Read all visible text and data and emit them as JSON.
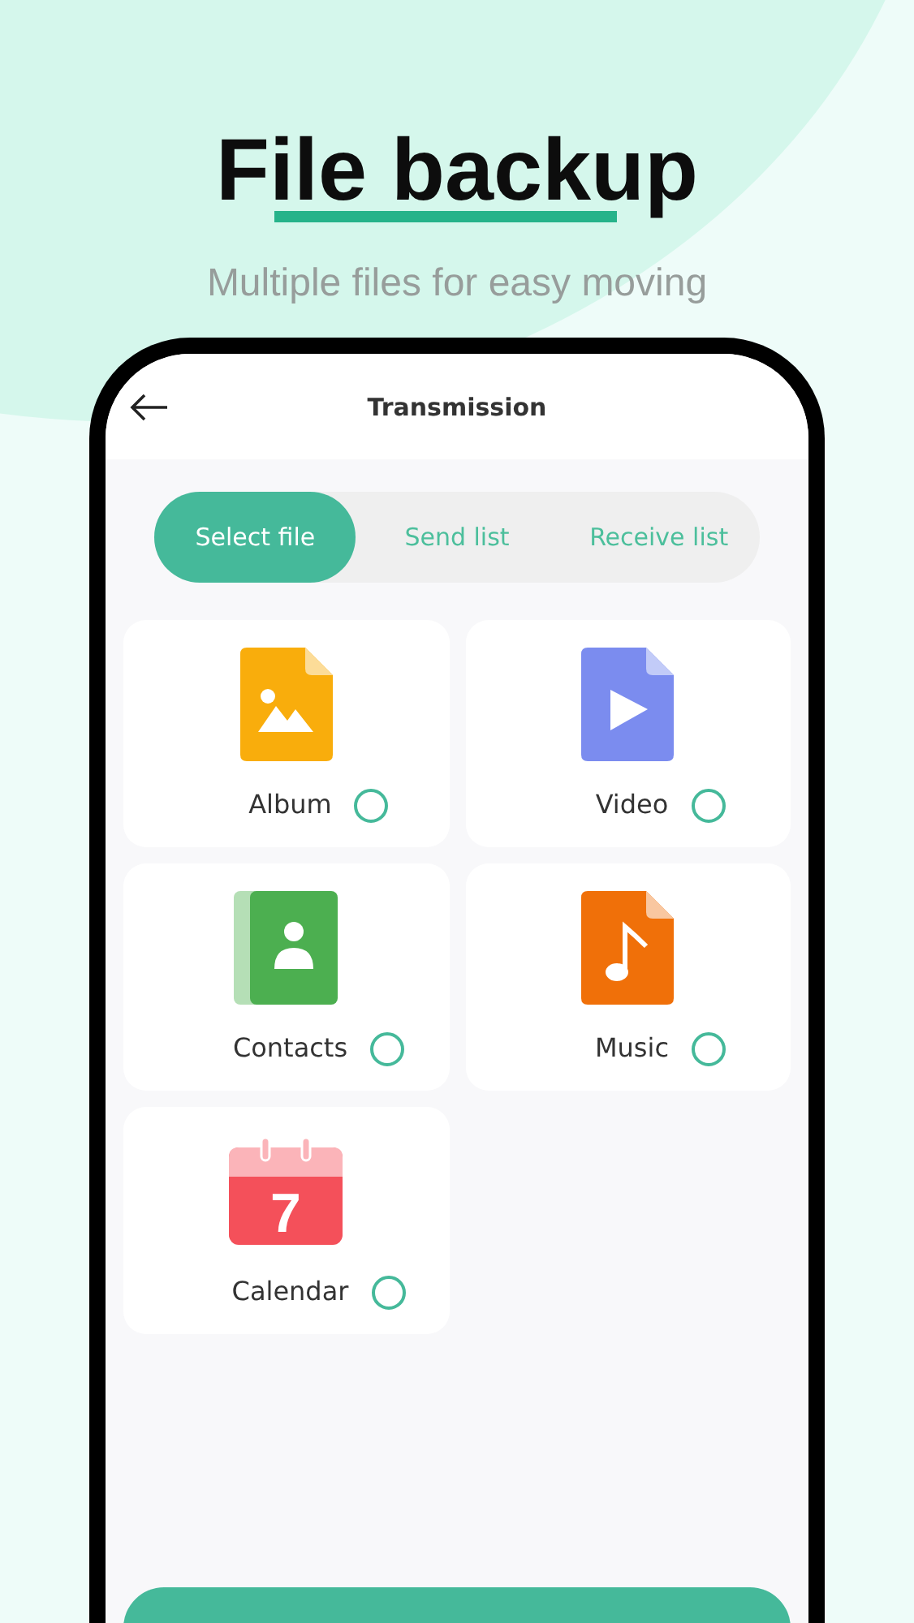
{
  "headline": "File backup",
  "subtitle": "Multiple files for easy moving",
  "screen": {
    "title": "Transmission"
  },
  "tabs": [
    {
      "label": "Select file",
      "selected": true
    },
    {
      "label": "Send list",
      "selected": false
    },
    {
      "label": "Receive list",
      "selected": false
    }
  ],
  "file_types": [
    {
      "kind": "image",
      "label": "Album",
      "checked": false
    },
    {
      "kind": "video",
      "label": "Video",
      "checked": false
    },
    {
      "kind": "contacts",
      "label": "Contacts",
      "checked": false
    },
    {
      "kind": "music",
      "label": "Music",
      "checked": false
    },
    {
      "kind": "calendar",
      "label": "Calendar",
      "day": "7",
      "checked": false
    }
  ]
}
